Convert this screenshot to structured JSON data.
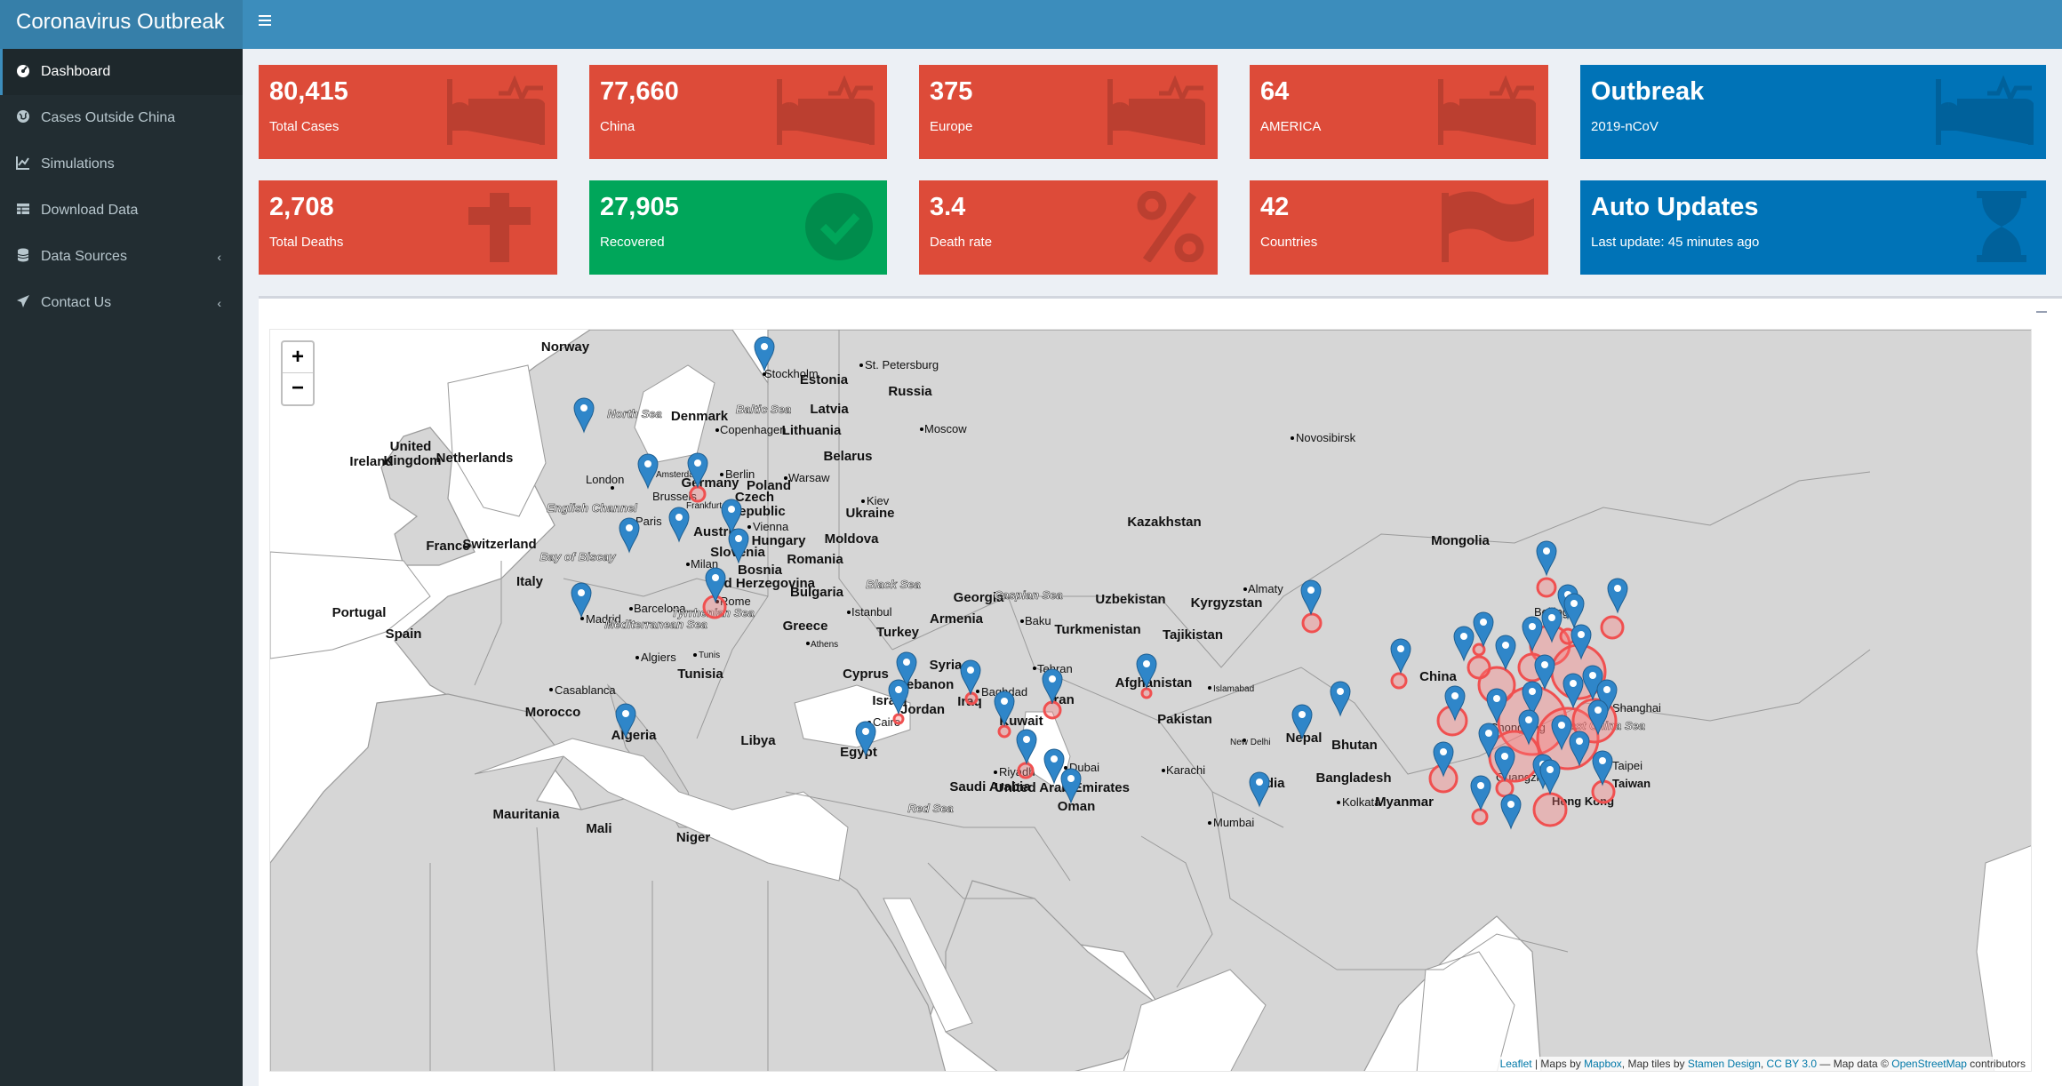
{
  "app": {
    "title": "Coronavirus Outbreak"
  },
  "sidebar": {
    "items": [
      {
        "label": "Dashboard",
        "icon": "dashboard-icon",
        "active": true
      },
      {
        "label": "Cases Outside China",
        "icon": "globe-icon"
      },
      {
        "label": "Simulations",
        "icon": "line-chart-icon"
      },
      {
        "label": "Download Data",
        "icon": "table-icon"
      },
      {
        "label": "Data Sources",
        "icon": "database-icon",
        "caret": "‹"
      },
      {
        "label": "Contact Us",
        "icon": "paper-plane-icon",
        "caret": "‹"
      }
    ]
  },
  "stats": [
    {
      "value": "80,415",
      "label": "Total Cases",
      "color": "#dd4b39",
      "icon": "bed-icon"
    },
    {
      "value": "77,660",
      "label": "China",
      "color": "#dd4b39",
      "icon": "bed-icon"
    },
    {
      "value": "375",
      "label": "Europe",
      "color": "#dd4b39",
      "icon": "bed-icon"
    },
    {
      "value": "64",
      "label": "AMERICA",
      "color": "#dd4b39",
      "icon": "bed-icon"
    },
    {
      "value": "Outbreak",
      "label": "2019-nCoV",
      "color": "#0073b7",
      "icon": "bed-icon"
    },
    {
      "value": "2,708",
      "label": "Total Deaths",
      "color": "#dd4b39",
      "icon": "cross-icon"
    },
    {
      "value": "27,905",
      "label": "Recovered",
      "color": "#00a65a",
      "icon": "check-circle-icon"
    },
    {
      "value": "3.4",
      "label": "Death rate",
      "color": "#dd4b39",
      "icon": "percent-icon"
    },
    {
      "value": "42",
      "label": "Countries",
      "color": "#dd4b39",
      "icon": "flag-icon"
    },
    {
      "value": "Auto Updates",
      "label": "Last update: 45 minutes ago",
      "color": "#0073b7",
      "icon": "hourglass-icon"
    }
  ],
  "map": {
    "zoom_in": "+",
    "zoom_out": "−",
    "attribution": {
      "leaflet": "Leaflet",
      "maps_by": " | Maps by ",
      "mapbox": "Mapbox",
      "tiles_by": ", Map tiles by ",
      "stamen": "Stamen Design",
      "sep": ", ",
      "license": "CC BY 3.0",
      "data": " — Map data © ",
      "osm": "OpenStreetMap",
      "contributors": " contributors"
    },
    "countries": [
      "Norway",
      "Russia",
      "Estonia",
      "Latvia",
      "Lithuania",
      "Denmark",
      "Belarus",
      "United",
      "Kingdom",
      "Ireland",
      "Netherlands",
      "Poland",
      "Czech",
      "Republic",
      "Ukraine",
      "Germany",
      "Austria",
      "Hungary",
      "Moldova",
      "Romania",
      "France",
      "Switzerland",
      "Slovenia",
      "Bosnia",
      "and Herzegovina",
      "Bulgaria",
      "Italy",
      "Portugal",
      "Spain",
      "Greece",
      "Turkey",
      "Georgia",
      "Armenia",
      "Kazakhstan",
      "Uzbekistan",
      "Kyrgyzstan",
      "Turkmenistan",
      "Tajikistan",
      "Mongolia",
      "China",
      "Syria",
      "Lebanon",
      "Cyprus",
      "Israel",
      "Jordan",
      "Iraq",
      "Iran",
      "Kuwait",
      "Afghanistan",
      "Pakistan",
      "Nepal",
      "Bhutan",
      "Bangladesh",
      "Myanmar",
      "Tunisia",
      "Morocco",
      "Algeria",
      "Libya",
      "Egypt",
      "Saudi Arabia",
      "United Arab Emirates",
      "Oman",
      "Mauritania",
      "Mali",
      "Niger",
      "India"
    ],
    "cities": [
      "Stockholm",
      "St. Petersburg",
      "Moscow",
      "Copenhagen",
      "Berlin",
      "Warsaw",
      "Amsterdam",
      "London",
      "Brussels",
      "Frankfurt",
      "Paris",
      "Vienna",
      "Kiev",
      "Milan",
      "Rome",
      "Barcelona",
      "Madrid",
      "Algiers",
      "Tunis",
      "Casablanca",
      "Athens",
      "Istanbul",
      "Baku",
      "Tehran",
      "Baghdad",
      "Cairo",
      "Riyadh",
      "Dubai",
      "Karachi",
      "Islamabad",
      "New Delhi",
      "Mumbai",
      "Kolkata",
      "Novosibirsk",
      "Almaty",
      "Beijing",
      "Chongqing",
      "Guangzhou",
      "Hong Kong",
      "Taipei",
      "Taiwan",
      "Shanghai"
    ],
    "seas": [
      "North Sea",
      "Baltic Sea",
      "English Channel",
      "Bay of Biscay",
      "Mediterranean Sea",
      "Tyrrhenian Sea",
      "Black Sea",
      "Caspian Sea",
      "Red Sea",
      "East China Sea"
    ]
  }
}
